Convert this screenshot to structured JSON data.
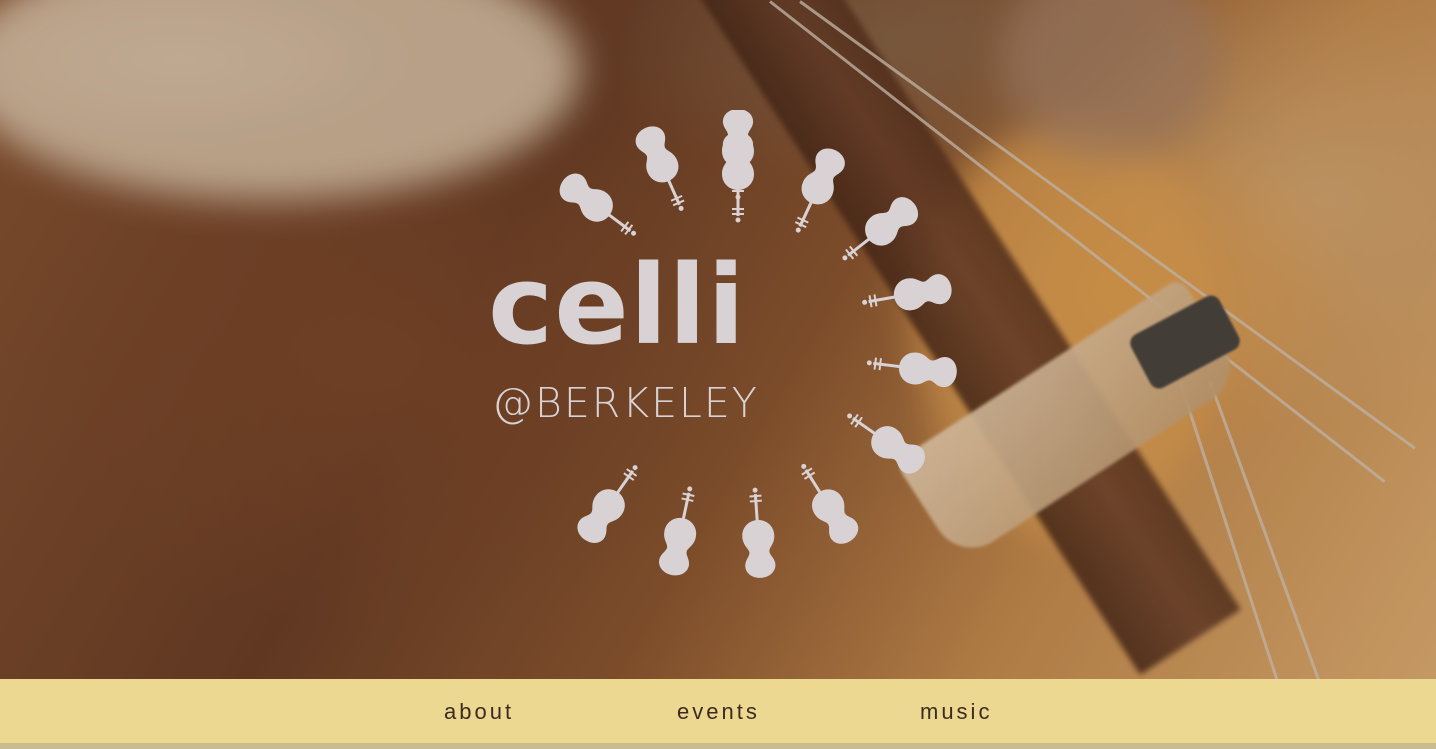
{
  "logo": {
    "title": "celli",
    "subtitle": "@BERKELEY",
    "icon": "cello-ring-icon",
    "color": "#d8d2d4"
  },
  "nav": {
    "background": "#ecd890",
    "items": [
      {
        "label": "about"
      },
      {
        "label": "events"
      },
      {
        "label": "music"
      }
    ]
  }
}
